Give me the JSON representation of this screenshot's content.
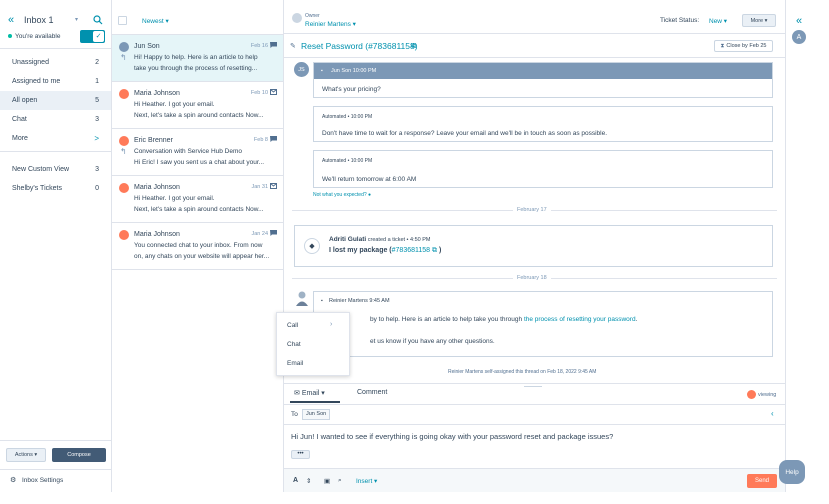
{
  "sidebar": {
    "inbox_title": "Inbox 1",
    "availability": "You're available",
    "items": [
      {
        "label": "Unassigned",
        "count": "2"
      },
      {
        "label": "Assigned to me",
        "count": "1"
      },
      {
        "label": "All open",
        "count": "5"
      },
      {
        "label": "Chat",
        "count": "3"
      },
      {
        "label": "More",
        "count": ">"
      },
      {
        "label": "New Custom View",
        "count": "3"
      },
      {
        "label": "Shelby's Tickets",
        "count": "0"
      }
    ],
    "actions_label": "Actions ▾",
    "compose_label": "Compose",
    "settings_label": "Inbox Settings"
  },
  "list": {
    "sort_label": "Newest ▾",
    "conversations": [
      {
        "name": "Jun Son",
        "date": "Feb 16",
        "line1": "Hi! Happy to help. Here is an article to help",
        "line2": "take you through the process of resetting...",
        "avatar_color": "#7c98b6",
        "channel": "chat",
        "reply": true
      },
      {
        "name": "Maria Johnson",
        "date": "Feb 10",
        "line1": "Hi Heather. I got your email.",
        "line2": "Next, let's take a spin around contacts Now...",
        "avatar_color": "#ff7a59",
        "channel": "email",
        "reply": false
      },
      {
        "name": "Eric Brenner",
        "date": "Feb 8",
        "line1": "Conversation with Service Hub Demo",
        "line2": "Hi Eric! I saw you sent us a chat about your...",
        "avatar_color": "#ff7a59",
        "channel": "chat",
        "reply": true
      },
      {
        "name": "Maria Johnson",
        "date": "Jan 31",
        "line1": "Hi Heather. I got your email.",
        "line2": "Next, let's take a spin around contacts Now...",
        "avatar_color": "#ff7a59",
        "channel": "email",
        "reply": false
      },
      {
        "name": "Maria Johnson",
        "date": "Jan 24",
        "line1": "You connected chat to your inbox. From now",
        "line2": "on, any chats on your website will appear her...",
        "avatar_color": "#ff7a59",
        "channel": "chat",
        "reply": false
      }
    ]
  },
  "thread": {
    "owner_label": "Owner",
    "owner_name": "Reinier Martens ▾",
    "ticket_status_label": "Ticket Status:",
    "ticket_status_value": "New ▾",
    "more_label": "More ▾",
    "ticket_title": "Reset Password (#783681158)",
    "close_by": "Close by Feb 25",
    "msg1_initials": "JS",
    "msg1_header": "Jun Son   10:00 PM",
    "msg1_text": "What's your pricing?",
    "auto1_label": "Automated • 10:00 PM",
    "auto1_text": "Don't have time to wait for a response? Leave your email and we'll be in touch as soon as possible.",
    "auto2_label": "Automated • 10:00 PM",
    "auto2_text": "We'll return tomorrow at 6:00 AM",
    "not_expected": "Not what you expected?",
    "date_sep1": "February 17",
    "ticket_creator": "Adriti Gulati",
    "ticket_created_text": " created a ticket • 4:50 PM",
    "ticket_name_prefix": "I lost my package (",
    "ticket_name_link": "#783681158",
    "ticket_name_suffix": ")",
    "date_sep2": "February 18",
    "agent_header": "Reinier Martens   9:45 AM",
    "agent_text_pre": "by to help. Here is an article to help take you through ",
    "agent_text_link": "the process of resetting your password",
    "agent_text_post": ".",
    "agent_text2": "et us know if you have any other questions.",
    "assigned_note": "Reinier Martens self-assigned this thread on Feb 18, 2022 9:45 AM",
    "menu_items": [
      "Call",
      "Chat",
      "Email"
    ]
  },
  "composer": {
    "tab_email": "Email ▾",
    "tab_comment": "Comment",
    "viewing": "viewing",
    "to_label": "To",
    "to_value": "Jun Son",
    "body": "Hi Jun! I wanted to see if everything is going okay with your password reset and package issues?",
    "insert_label": "Insert ▾",
    "send_label": "Send",
    "help_label": "Help"
  },
  "rail": {
    "avatar_letter": "A"
  },
  "colors": {
    "accent": "#0091ae",
    "orange": "#ff7a59",
    "dark_header": "#7c98b6",
    "compose_bg": "#425b76"
  }
}
